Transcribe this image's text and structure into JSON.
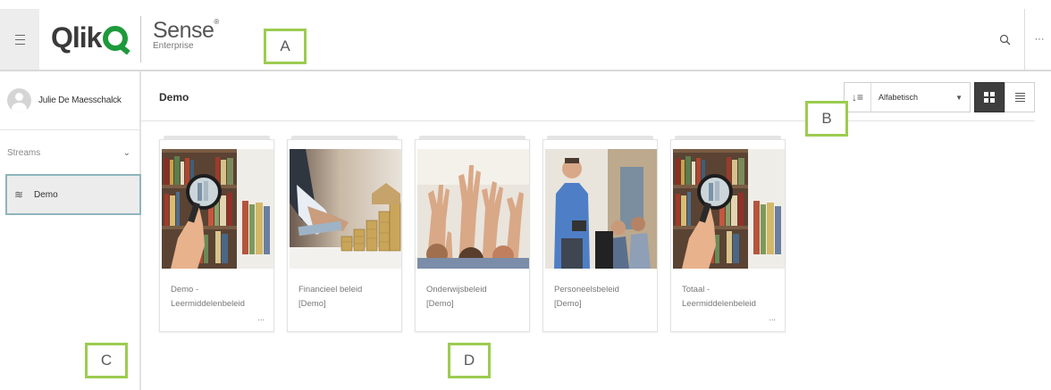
{
  "header": {
    "logo_text": "Qlik",
    "product_name": "Sense",
    "product_trademark": "®",
    "product_edition": "Enterprise",
    "more_label": "···"
  },
  "sidebar": {
    "user_name": "Julie De Maesschalck",
    "streams_label": "Streams",
    "streams": [
      {
        "label": "Demo",
        "selected": true
      }
    ]
  },
  "main": {
    "stream_title": "Demo",
    "sort_value": "Alfabetisch",
    "view_mode": "grid"
  },
  "apps": [
    {
      "title": "Demo -",
      "subtitle": "Leermiddelenbeleid",
      "truncated": true,
      "thumbnail": "bookshelf-magnifier"
    },
    {
      "title": "Financieel beleid",
      "subtitle": "[Demo]",
      "truncated": false,
      "thumbnail": "coins-calculator"
    },
    {
      "title": "Onderwijsbeleid",
      "subtitle": "[Demo]",
      "truncated": false,
      "thumbnail": "raised-hands"
    },
    {
      "title": "Personeelsbeleid",
      "subtitle": "[Demo]",
      "truncated": false,
      "thumbnail": "teacher-classroom"
    },
    {
      "title": "Totaal -",
      "subtitle": "Leermiddelenbeleid",
      "truncated": true,
      "thumbnail": "bookshelf-magnifier"
    }
  ],
  "ellipsis_label": "...",
  "annotations": {
    "a": "A",
    "b": "B",
    "c": "C",
    "d": "D"
  },
  "colors": {
    "brand_green": "#1e9a3c",
    "marker_green": "#9ccc50",
    "selected_border": "#8fb5bd",
    "dark_toggle": "#3e3e3e"
  }
}
